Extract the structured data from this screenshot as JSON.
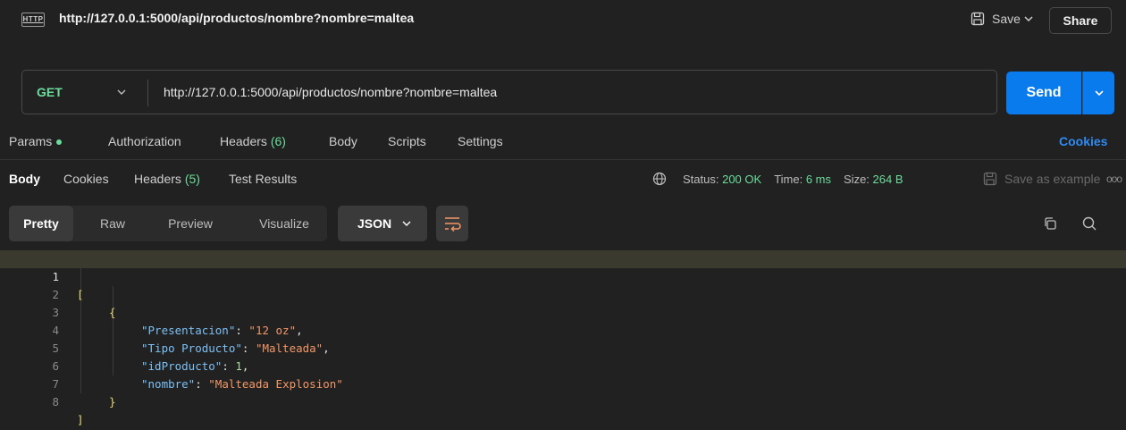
{
  "request": {
    "title": "http://127.0.0.1:5000/api/productos/nombre?nombre=maltea",
    "save_label": "Save",
    "share_label": "Share",
    "method": "GET",
    "url": "http://127.0.0.1:5000/api/productos/nombre?nombre=maltea",
    "send_label": "Send"
  },
  "request_tabs": {
    "params": "Params",
    "authorization": "Authorization",
    "headers": "Headers",
    "headers_count": "(6)",
    "body": "Body",
    "scripts": "Scripts",
    "settings": "Settings",
    "cookies": "Cookies"
  },
  "response_tabs": {
    "body": "Body",
    "cookies": "Cookies",
    "headers": "Headers",
    "headers_count": "(5)",
    "test_results": "Test Results",
    "status_label": "Status:",
    "status_value": "200 OK",
    "time_label": "Time:",
    "time_value": "6 ms",
    "size_label": "Size:",
    "size_value": "264 B",
    "save_example": "Save as example",
    "more": "ooo"
  },
  "format_bar": {
    "pretty": "Pretty",
    "raw": "Raw",
    "preview": "Preview",
    "visualize": "Visualize",
    "format": "JSON"
  },
  "editor": {
    "line_numbers": [
      "1",
      "2",
      "3",
      "4",
      "5",
      "6",
      "7",
      "8"
    ],
    "open_bracket": "[",
    "open_brace": "{",
    "close_brace": "}",
    "close_bracket": "]",
    "fields": [
      {
        "key": "\"Presentacion\"",
        "value": "\"12 oz\"",
        "type": "string"
      },
      {
        "key": "\"Tipo Producto\"",
        "value": "\"Malteada\"",
        "type": "string"
      },
      {
        "key": "\"idProducto\"",
        "value": "1",
        "type": "number"
      },
      {
        "key": "\"nombre\"",
        "value": "\"Malteada Explosion\"",
        "type": "string"
      }
    ]
  },
  "colors": {
    "accent_blue": "#097bed",
    "method_green": "#6bdd9a",
    "background": "#212121"
  }
}
